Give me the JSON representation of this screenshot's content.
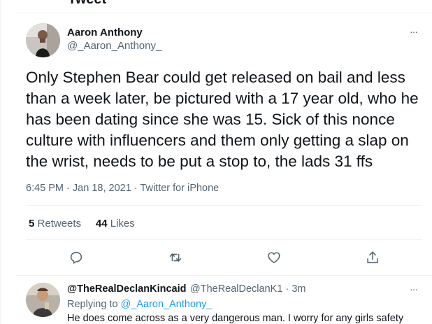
{
  "header": {
    "title": "Tweet"
  },
  "tweet": {
    "author_name": "Aaron Anthony",
    "author_handle": "@_Aaron_Anthony_",
    "text": "Only Stephen Bear could get released on bail and less than a week later, be pictured with a 17 year old, who he has been dating since she was 15. Sick of this nonce culture with influencers and them only getting a slap on the wrist, needs to be put a stop to, the lads 31 ffs",
    "time": "6:45 PM",
    "date": "Jan 18, 2021",
    "source": "Twitter for iPhone",
    "separator": "·",
    "retweets_count": "5",
    "retweets_label": "Retweets",
    "likes_count": "44",
    "likes_label": "Likes",
    "more_glyph": "···"
  },
  "actions": [
    {
      "name": "reply",
      "icon": "reply-icon"
    },
    {
      "name": "retweet",
      "icon": "retweet-icon"
    },
    {
      "name": "like",
      "icon": "heart-icon"
    },
    {
      "name": "share",
      "icon": "share-icon"
    }
  ],
  "reply": {
    "author_name": "@TheRealDeclanKincaid",
    "author_handle": "@TheRealDeclanK1",
    "separator": "·",
    "time_ago": "3m",
    "replying_prefix": "Replying to",
    "replying_to": "@_Aaron_Anthony_",
    "text": "He does come across as a very dangerous man. I worry for any girls safety",
    "more_glyph": "···"
  },
  "colors": {
    "accent": "#1d9bf0",
    "text": "#0f1419",
    "muted": "#536471",
    "border": "#eff3f4"
  }
}
